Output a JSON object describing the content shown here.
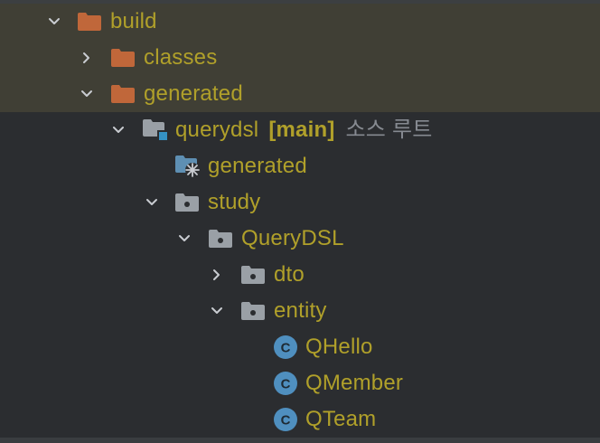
{
  "tree": {
    "build": {
      "label": "build"
    },
    "classes": {
      "label": "classes"
    },
    "generated_folder": {
      "label": "generated"
    },
    "querydsl": {
      "label": "querydsl",
      "module": "[main]",
      "suffix": "소스 루트"
    },
    "generated_pkg": {
      "label": "generated"
    },
    "study": {
      "label": "study"
    },
    "querydsl_pkg": {
      "label": "QueryDSL"
    },
    "dto": {
      "label": "dto"
    },
    "entity": {
      "label": "entity"
    },
    "classes_list": [
      {
        "label": "QHello",
        "icon": "class-c-icon"
      },
      {
        "label": "QMember",
        "icon": "class-c-icon"
      },
      {
        "label": "QTeam",
        "icon": "class-c-icon"
      }
    ]
  },
  "colors": {
    "background": "#2b2d30",
    "highlight_row": "#403f35",
    "excluded_text": "#b0a02a",
    "orange_folder": "#c0673a",
    "gray_folder": "#9aa0a6",
    "class_icon": "#4f8fbf"
  }
}
